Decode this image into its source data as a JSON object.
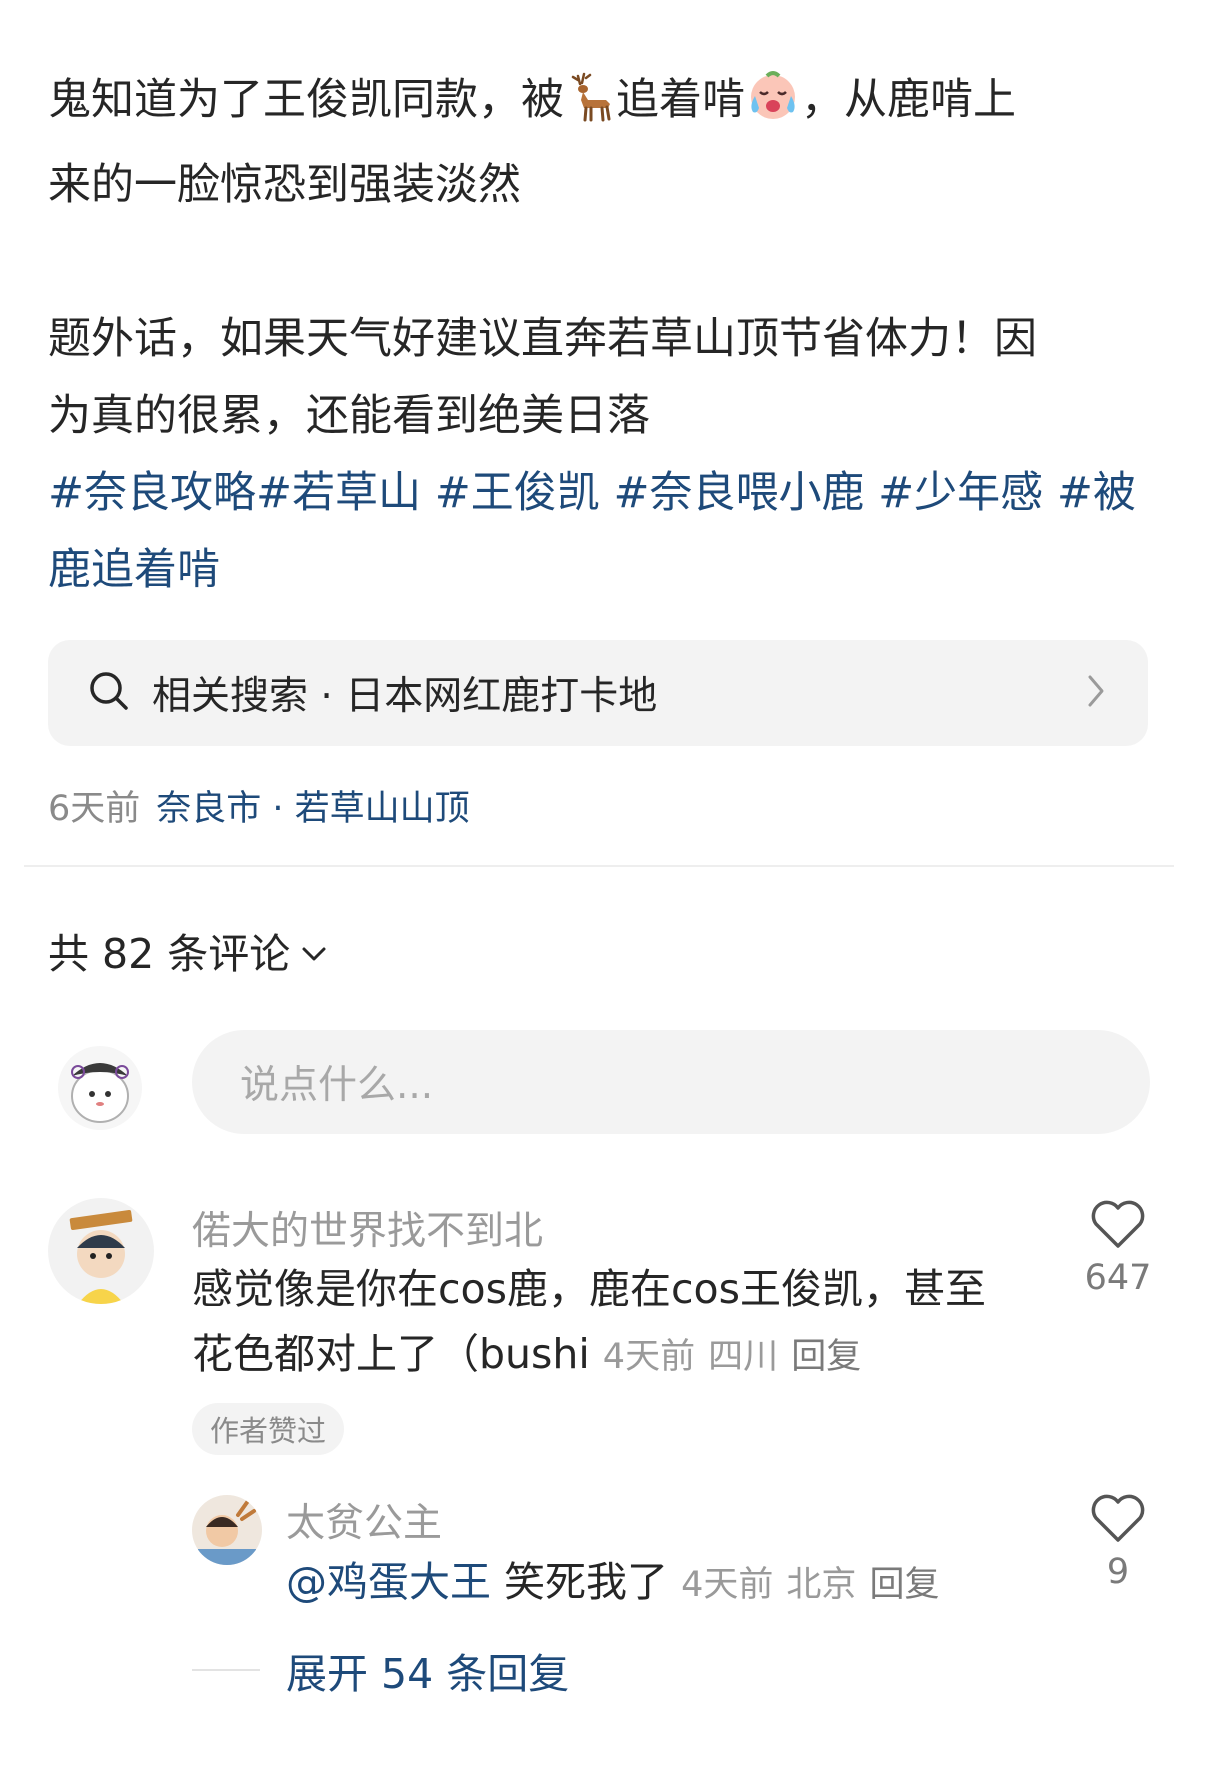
{
  "post": {
    "line1_a": "鬼知道为了王俊凯同款，被",
    "deer_emoji": "deer-emoji",
    "line1_b": "追着啃",
    "crying_emoji": "crying-face-emoji",
    "line1_c": "，从鹿啃上",
    "line2": "来的一脸惊恐到强装淡然",
    "line3": "题外话，如果天气好建议直奔若草山顶节省体力！因",
    "line4": "为真的很累，还能看到绝美日落",
    "hashtags": [
      "#奈良攻略",
      "#若草山",
      "#王俊凯",
      "#奈良喂小鹿",
      "#少年感",
      "#被鹿追着啃"
    ]
  },
  "related_search": {
    "label": "相关搜索 · 日本网红鹿打卡地",
    "icon": "search-icon",
    "chevron": "chevron-right-icon"
  },
  "meta": {
    "time": "6天前",
    "location": "奈良市 · 若草山山顶"
  },
  "comments_header": {
    "label": "共 82 条评论",
    "icon": "chevron-down-icon"
  },
  "composer": {
    "placeholder": "说点什么..."
  },
  "comments": [
    {
      "user": "偌大的世界找不到北",
      "text_line1": "感觉像是你在cos鹿，鹿在cos王俊凯，甚至",
      "text_line2": "花色都对上了（bushi",
      "time": "4天前",
      "location": "四川",
      "reply": "回复",
      "likes": "647",
      "badge": "作者赞过"
    }
  ],
  "reply": {
    "user": "太贫公主",
    "mention": "@鸡蛋大王",
    "text": "笑死我了",
    "time": "4天前",
    "location": "北京",
    "reply": "回复",
    "likes": "9"
  },
  "expand": {
    "label": "展开 54 条回复"
  },
  "colors": {
    "link": "#1e4a7a",
    "muted": "#9a9a9a",
    "panel": "#f3f3f3"
  }
}
